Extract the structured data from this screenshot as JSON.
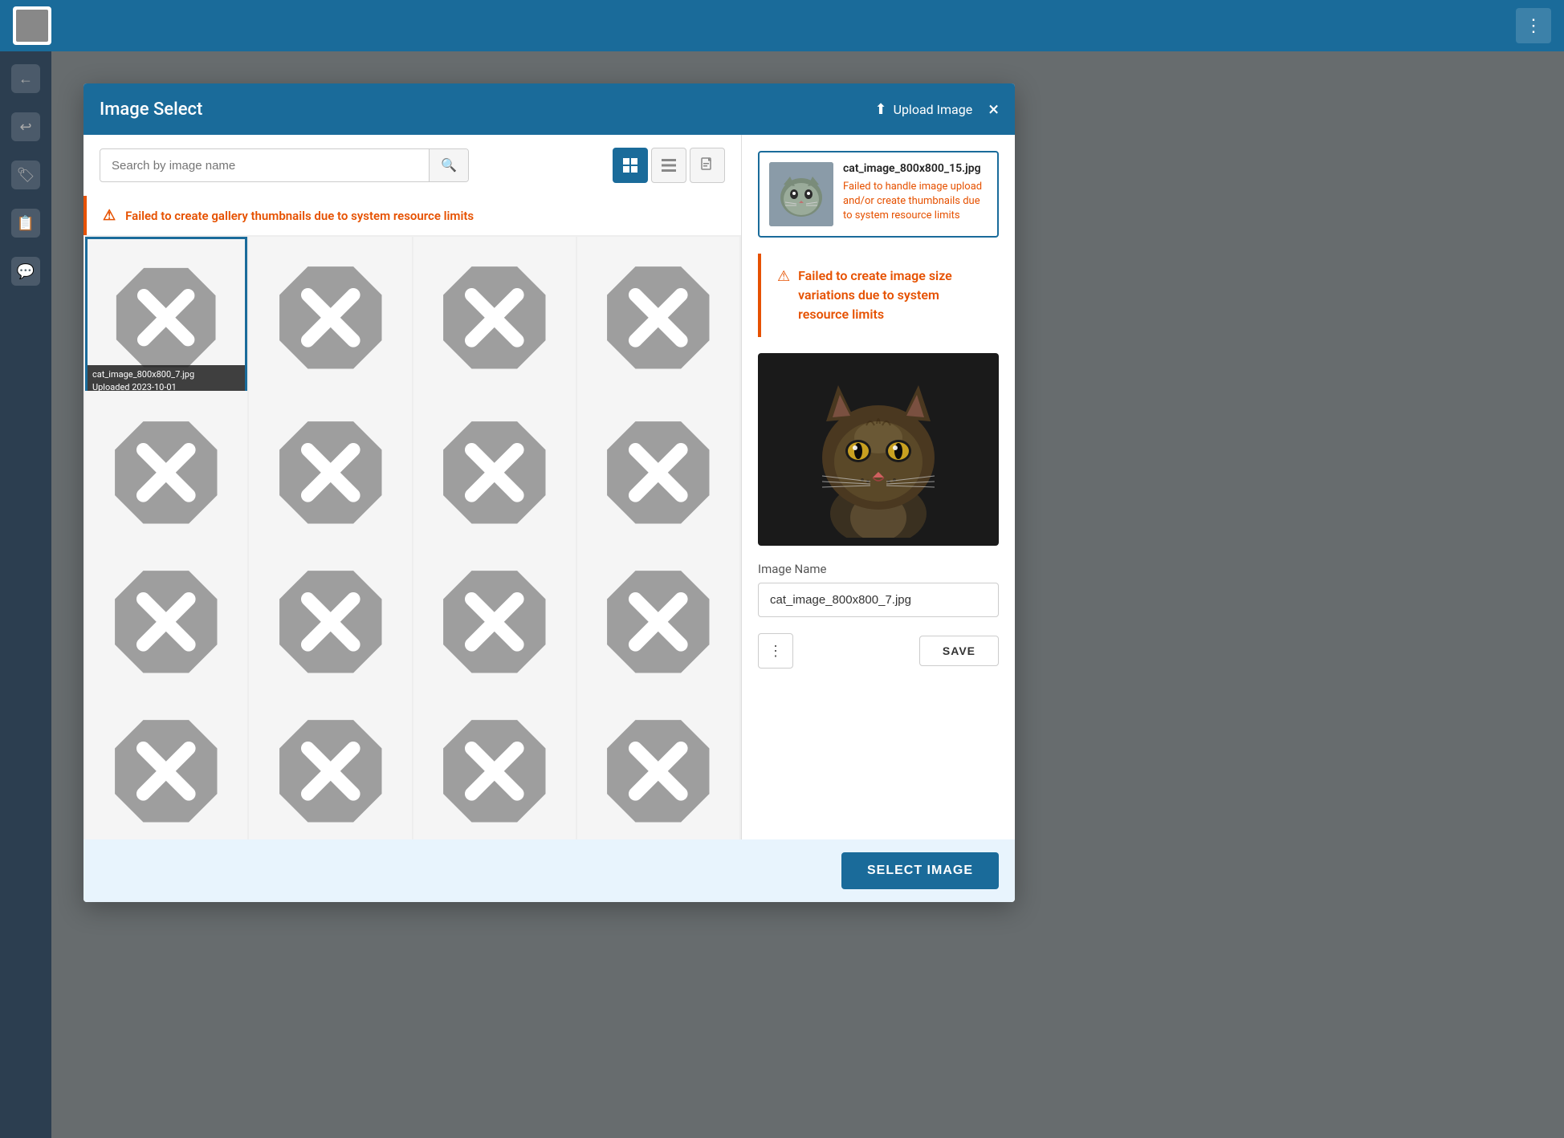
{
  "modal": {
    "title": "Image Select",
    "upload_label": "Upload Image",
    "close_label": "×"
  },
  "search": {
    "placeholder": "Search by image name",
    "icon": "🔍"
  },
  "view_toggle": {
    "grid_label": "Grid View",
    "list_label": "List View",
    "file_label": "File View"
  },
  "error_banner": {
    "message": "Failed to create gallery thumbnails due to system resource limits"
  },
  "gallery": {
    "items": [
      {
        "id": 1,
        "filename": "cat_image_800x800_7.jpg",
        "uploaded": "Uploaded 2023-10-01",
        "selected": true
      },
      {
        "id": 2,
        "filename": "",
        "uploaded": "",
        "selected": false
      },
      {
        "id": 3,
        "filename": "",
        "uploaded": "",
        "selected": false
      },
      {
        "id": 4,
        "filename": "",
        "uploaded": "",
        "selected": false
      },
      {
        "id": 5,
        "filename": "",
        "uploaded": "",
        "selected": false
      },
      {
        "id": 6,
        "filename": "",
        "uploaded": "",
        "selected": false
      },
      {
        "id": 7,
        "filename": "",
        "uploaded": "",
        "selected": false
      },
      {
        "id": 8,
        "filename": "",
        "uploaded": "",
        "selected": false
      },
      {
        "id": 9,
        "filename": "",
        "uploaded": "",
        "selected": false
      },
      {
        "id": 10,
        "filename": "",
        "uploaded": "",
        "selected": false
      },
      {
        "id": 11,
        "filename": "",
        "uploaded": "",
        "selected": false
      },
      {
        "id": 12,
        "filename": "",
        "uploaded": "",
        "selected": false
      }
    ]
  },
  "right_panel": {
    "upload_card": {
      "filename": "cat_image_800x800_15.jpg",
      "error": "Failed to handle image upload and/or create thumbnails due to system resource limits"
    },
    "size_error": {
      "message": "Failed to create image size variations due to system resource limits"
    },
    "image_name_label": "Image Name",
    "image_name_value": "cat_image_800x800_7.jpg",
    "more_icon": "⋮",
    "save_label": "SAVE"
  },
  "footer": {
    "select_image_label": "SELECT IMAGE"
  },
  "sidebar": {
    "icons": [
      "←",
      "↩",
      "🏷",
      "📋",
      "💬"
    ]
  }
}
